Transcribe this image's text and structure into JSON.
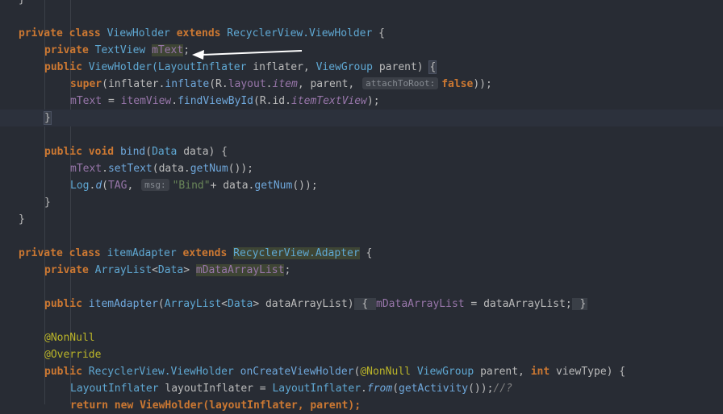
{
  "code": {
    "line1": {
      "t1": "}"
    },
    "line2": {
      "t1": "private",
      "t2": " ",
      "t3": "class",
      "t4": " ViewHolder ",
      "t5": "extends",
      "t6": " RecyclerView.ViewHolder",
      "t7": " {"
    },
    "line3": {
      "t1": "private",
      "t2": " TextView ",
      "t3": "mText",
      "t4": ";"
    },
    "line4": {
      "t1": "public",
      "t2": " ViewHolder(",
      "t3": "LayoutInflater",
      "t4": " inflater, ",
      "t5": "ViewGroup",
      "t6": " parent) ",
      "t7": "{"
    },
    "line5": {
      "t1": "super",
      "t2": "(inflater.",
      "t3": "inflate",
      "t4": "(R.",
      "t5": "layout",
      "t6": ".",
      "t7": "item",
      "t8": ", parent, ",
      "hint": "attachToRoot:",
      "t9": "false",
      "t10": "));"
    },
    "line6": {
      "t1": "mText",
      "t2": " = ",
      "t3": "itemView",
      "t4": ".",
      "t5": "findViewById",
      "t6": "(R.id.",
      "t7": "itemTextView",
      "t8": ");"
    },
    "line7": {
      "t1": "}"
    },
    "line9": {
      "t1": "public",
      "t2": " ",
      "t3": "void",
      "t4": " ",
      "t5": "bind",
      "t6": "(",
      "t7": "Data",
      "t8": " data) {"
    },
    "line10": {
      "t1": "mText",
      "t2": ".",
      "t3": "setText",
      "t4": "(data.",
      "t5": "getNum",
      "t6": "());"
    },
    "line11": {
      "t1": "Log",
      "t2": ".",
      "t3": "d",
      "t4": "(",
      "t5": "TAG",
      "t6": ", ",
      "hint": "msg:",
      "t7": "\"Bind\"",
      "t8": "+ data.",
      "t9": "getNum",
      "t10": "());"
    },
    "line12": {
      "t1": "}"
    },
    "line13": {
      "t1": "}"
    },
    "line15": {
      "t1": "private",
      "t2": " ",
      "t3": "class",
      "t4": " itemAdapter ",
      "t5": "extends",
      "t6": " ",
      "t7": "RecyclerView.Adapter",
      "t8": " {"
    },
    "line16": {
      "t1": "private",
      "t2": " ",
      "t3": "ArrayList",
      "t4": "<",
      "t5": "Data",
      "t6": "> ",
      "t7": "mDataArrayList",
      "t8": ";"
    },
    "line18": {
      "t1": "public",
      "t2": " ",
      "t3": "itemAdapter",
      "t4": "(",
      "t5": "ArrayList",
      "t6": "<",
      "t7": "Data",
      "t8": "> dataArrayList)",
      "t9": " { ",
      "t10": "mDataArrayList",
      "t11": " = dataArrayList;",
      "t12": " }"
    },
    "line20": {
      "t1": "@NonNull"
    },
    "line21": {
      "t1": "@Override"
    },
    "line22": {
      "t1": "public",
      "t2": " RecyclerView.ViewHolder ",
      "t3": "onCreateViewHolder",
      "t4": "(",
      "t5": "@NonNull",
      "t6": " ",
      "t7": "ViewGroup",
      "t8": " parent, ",
      "t9": "int",
      "t10": " viewType) {"
    },
    "line23": {
      "t1": "LayoutInflater",
      "t2": " layoutInflater = ",
      "t3": "LayoutInflater",
      "t4": ".",
      "t5": "from",
      "t6": "(",
      "t7": "getActivity",
      "t8": "());",
      "t9": "//?"
    },
    "line24": {
      "t1": "return new ViewHolder(layoutInflater, parent);"
    }
  },
  "colors": {
    "background": "#282c34",
    "keyword": "#cc7832",
    "type": "#5fa8d3",
    "field": "#9876aa",
    "string": "#6a8759",
    "annotation": "#bbb529",
    "arrow": "#ffffff"
  },
  "icons": {
    "annotation_arrow": "arrow-icon"
  }
}
